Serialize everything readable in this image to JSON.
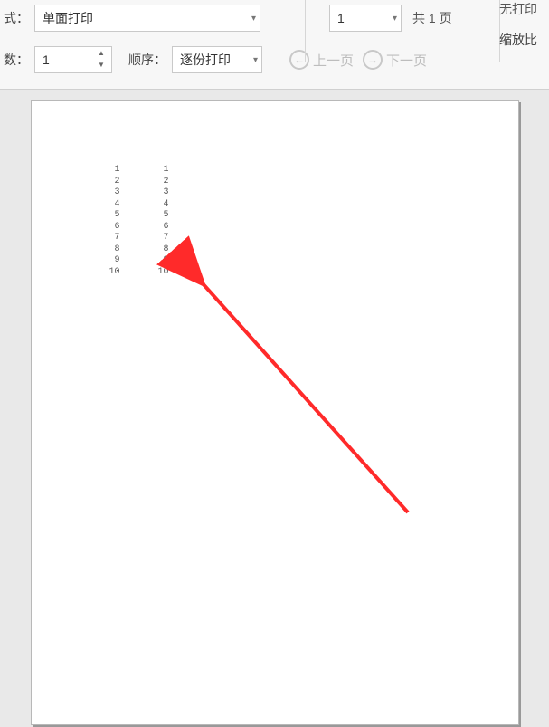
{
  "toolbar": {
    "mode_label": "式：",
    "mode_value": "单面打印",
    "copies_label": "数：",
    "copies_value": "1",
    "order_label": "顺序：",
    "order_value": "逐份打印",
    "page_selector_value": "1",
    "page_count_text": "共 1 页",
    "prev_label": "上一页",
    "next_label": "下一页",
    "fit_value": "无打印",
    "zoom_label": "缩放比"
  },
  "page_content": {
    "rows": [
      {
        "a": "1",
        "b": "1"
      },
      {
        "a": "2",
        "b": "2"
      },
      {
        "a": "3",
        "b": "3"
      },
      {
        "a": "4",
        "b": "4"
      },
      {
        "a": "5",
        "b": "5"
      },
      {
        "a": "6",
        "b": "6"
      },
      {
        "a": "7",
        "b": "7"
      },
      {
        "a": "8",
        "b": "8"
      },
      {
        "a": "9",
        "b": "9"
      },
      {
        "a": "10",
        "b": "10"
      }
    ]
  },
  "annotation": {
    "color": "#ff2a2a"
  }
}
